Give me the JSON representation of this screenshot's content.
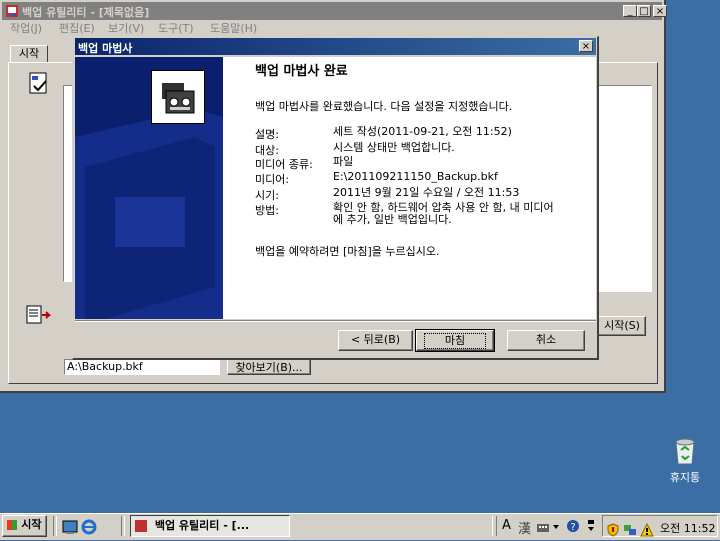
{
  "app": {
    "title": "백업 유틸리티 - [제목없음]",
    "menu": [
      "작업(J)",
      "편집(E)",
      "보기(V)",
      "도구(T)",
      "도움말(H)"
    ],
    "tab": "시작",
    "start_button": "시작(S)",
    "browse_button": "찾아보기(B)...",
    "path_value": "A:\\Backup.bkf"
  },
  "dialog": {
    "title": "백업 마법사",
    "heading": "백업 마법사 완료",
    "intro": "백업 마법사를 완료했습니다. 다음 설정을 지정했습니다.",
    "rows": [
      {
        "label": "설명:",
        "value": "세트 작성(2011-09-21, 오전 11:52)"
      },
      {
        "label": "대상:",
        "value": "시스템 상태만 백업합니다."
      },
      {
        "label": "미디어 종류:",
        "value": "파일"
      },
      {
        "label": "미디어:",
        "value": "E:\\201109211150_Backup.bkf"
      },
      {
        "label": "시기:",
        "value": "2011년 9월 21일 수요일 / 오전 11:53"
      },
      {
        "label": "방법:",
        "value": "확인 안 함, 하드웨어 압축 사용 안 함, 내 미디어에 추가, 일반 백업입니다."
      }
    ],
    "footer": "백업을 예약하려면 [마침]을 누르십시오.",
    "back_button": "< 뒤로(B)",
    "finish_button": "마침",
    "cancel_button": "취소",
    "close_glyph": "×"
  },
  "desktop": {
    "recycle_bin": "휴지통"
  },
  "taskbar": {
    "start": "시작",
    "task": "백업 유틸리티 - [...",
    "ime_a": "A",
    "ime_han": "漢",
    "clock": "오전 11:52"
  }
}
